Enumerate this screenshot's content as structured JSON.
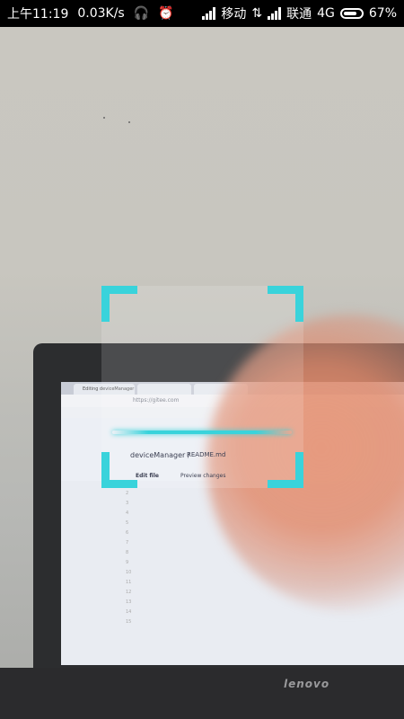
{
  "status_bar": {
    "time": "上午11:19",
    "speed": "0.03K/s",
    "carrier1": "移动",
    "carrier2": "联通",
    "network": "4G",
    "battery": "67%"
  },
  "laptop": {
    "brand": "lenovo",
    "tab1": "Editing deviceManager",
    "url": "https://gitee.com",
    "repo": "deviceManager /",
    "file": "README.md",
    "edit_tab": "Edit file",
    "preview_tab": "Preview changes",
    "line_numbers": [
      "1",
      "2",
      "3",
      "4",
      "5",
      "6",
      "7",
      "8",
      "9",
      "10",
      "11",
      "12",
      "13",
      "14",
      "15"
    ]
  },
  "colors": {
    "scanner_accent": "#39d3db",
    "statusbar_bg": "#000000"
  }
}
